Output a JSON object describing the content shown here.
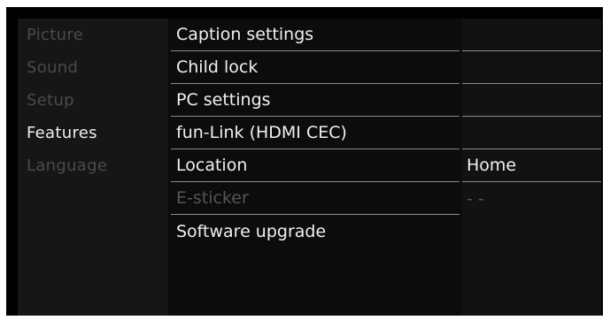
{
  "main_menu": {
    "items": [
      {
        "label": "Picture",
        "active": false
      },
      {
        "label": "Sound",
        "active": false
      },
      {
        "label": "Setup",
        "active": false
      },
      {
        "label": "Features",
        "active": true
      },
      {
        "label": "Language",
        "active": false
      }
    ]
  },
  "features_menu": {
    "items": [
      {
        "label": "Caption settings",
        "value": "",
        "enabled": true
      },
      {
        "label": "Child lock",
        "value": "",
        "enabled": true
      },
      {
        "label": "PC settings",
        "value": "",
        "enabled": true
      },
      {
        "label": "fun-Link (HDMI CEC)",
        "value": "",
        "enabled": true
      },
      {
        "label": "Location",
        "value": "Home",
        "enabled": true
      },
      {
        "label": "E-sticker",
        "value": "- -",
        "enabled": false
      },
      {
        "label": "Software upgrade",
        "value": "",
        "enabled": true
      }
    ]
  }
}
